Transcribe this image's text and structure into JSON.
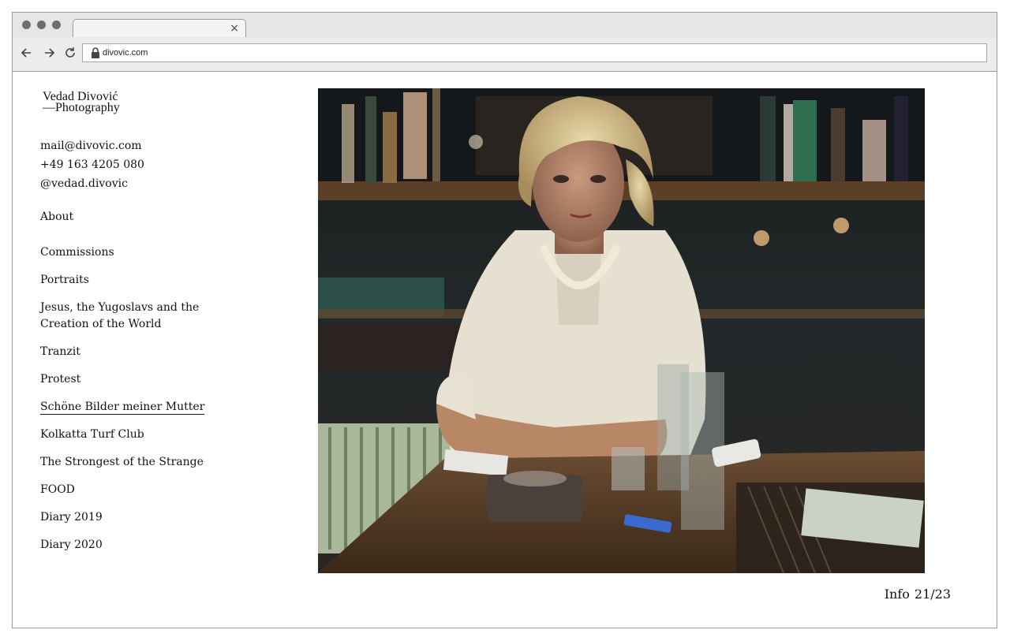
{
  "browser": {
    "tab": {
      "close_label": "×"
    },
    "url": "divovic.com"
  },
  "site": {
    "logo_line1": "Vedad Divović",
    "logo_line2": "—Photography",
    "contact": {
      "email": "mail@divovic.com",
      "phone": "+49 163 4205 080",
      "instagram": "@vedad.divovic"
    },
    "nav": {
      "about": "About",
      "items": [
        "Commissions",
        "Portraits",
        "Jesus, the Yugoslavs and the Creation of the World",
        "Tranzit",
        "Protest",
        "Schöne Bilder meiner Mutter",
        "Kolkatta Turf Club",
        "The Strongest of the Strange",
        "FOOD",
        "Diary 2019",
        "Diary 2020"
      ],
      "active_item": "Schöne Bilder meiner Mutter"
    },
    "footer": {
      "info_label": "Info",
      "counter": "21/23"
    }
  },
  "icons": {
    "back": "arrow-left-icon",
    "forward": "arrow-right-icon",
    "reload": "reload-icon",
    "lock": "lock-icon"
  },
  "colors": {
    "text": "#111111",
    "chrome": "#e6e6e6"
  }
}
